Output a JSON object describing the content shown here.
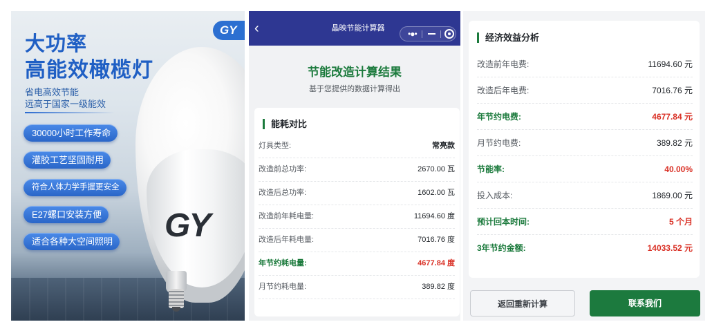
{
  "poster": {
    "brand_badge": "GY",
    "headline_line1": "大功率",
    "headline_line2": "高能效橄榄灯",
    "sub_line1": "省电高效节能",
    "sub_line2": "远高于国家一级能效",
    "features": [
      "30000小时工作寿命",
      "灌胶工艺坚固耐用",
      "符合人体力学手握更安全",
      "E27螺口安装方便",
      "适合各种大空间照明"
    ],
    "bulb_logo": "GY"
  },
  "calculator": {
    "topbar_title": "晶映节能计算器",
    "back_icon": "chevron-left-icon",
    "capsule_dots": "•●•",
    "result_title": "节能改造计算结果",
    "result_subtitle": "基于您提供的数据计算得出",
    "energy_section": {
      "title": "能耗对比",
      "rows": [
        {
          "label": "灯具类型:",
          "value": "常亮款",
          "style": "bold"
        },
        {
          "label": "改造前总功率:",
          "value": "2670.00 瓦",
          "style": "normal"
        },
        {
          "label": "改造后总功率:",
          "value": "1602.00 瓦",
          "style": "normal"
        },
        {
          "label": "改造前年耗电量:",
          "value": "11694.60 度",
          "style": "normal"
        },
        {
          "label": "改造后年耗电量:",
          "value": "7016.76 度",
          "style": "normal"
        },
        {
          "label": "年节约耗电量:",
          "value": "4677.84 度",
          "style": "highlight"
        },
        {
          "label": "月节约耗电量:",
          "value": "389.82 度",
          "style": "normal"
        }
      ]
    }
  },
  "economic": {
    "title": "经济效益分析",
    "rows": [
      {
        "label": "改造前年电费:",
        "value": "11694.60 元",
        "style": "normal"
      },
      {
        "label": "改造后年电费:",
        "value": "7016.76 元",
        "style": "normal"
      },
      {
        "label": "年节约电费:",
        "value": "4677.84 元",
        "style": "highlight"
      },
      {
        "label": "月节约电费:",
        "value": "389.82 元",
        "style": "normal"
      },
      {
        "label": "节能率:",
        "value": "40.00%",
        "style": "highlight"
      },
      {
        "label": "投入成本:",
        "value": "1869.00 元",
        "style": "normal"
      },
      {
        "label": "预计回本时间:",
        "value": "5 个月",
        "style": "highlight"
      },
      {
        "label": "3年节约金额:",
        "value": "14033.52 元",
        "style": "highlight"
      }
    ],
    "back_button_label": "返回重新计算",
    "contact_button_label": "联系我们"
  },
  "colors": {
    "brand_blue": "#2e3792",
    "accent_green": "#1b7a3c",
    "highlight_red": "#d93025"
  }
}
